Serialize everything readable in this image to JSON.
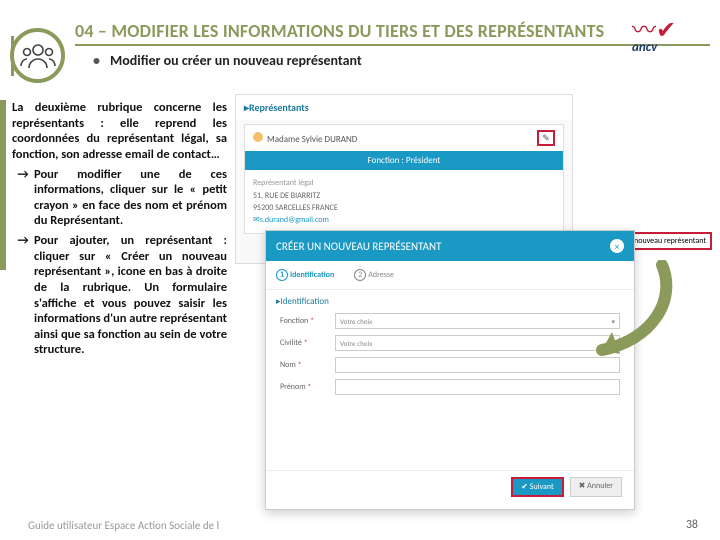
{
  "header": {
    "title": "04 – MODIFIER LES INFORMATIONS DU TIERS ET DES REPRÉSENTANTS",
    "subtitle": "Modifier ou créer un nouveau représentant"
  },
  "logo": {
    "brand": "ancv"
  },
  "body": {
    "intro": "La deuxième rubrique concerne les représentants : elle reprend les coordonnées du représentant légal, sa fonction, son adresse email de contact…",
    "point1": "Pour modifier une de ces informations, cliquer sur le « petit crayon » en face des nom et prénom du Représentant.",
    "point2": "Pour ajouter, un représentant : cliquer sur « Créer un nouveau représentant », icone en bas à droite de la rubrique. Un formulaire s'affiche et vous pouvez saisir les informations d'un autre représentant ainsi que sa fonction au sein de votre structure."
  },
  "ss1": {
    "section": "Représentants",
    "name_line": "Madame Sylvie DURAND",
    "func_label": "Fonction : Président",
    "legal": "Représentant légal",
    "addr1": "51, RUE DE BIARRITZ",
    "addr2": "95200 SARCELLES FRANCE",
    "mail": "s.durand@gmail.com"
  },
  "create_btn": "Créer un nouveau représentant",
  "ss2": {
    "title": "CRÉER UN NOUVEAU REPRÉSENTANT",
    "step1": "Identification",
    "step2": "Adresse",
    "section": "Identification",
    "labels": {
      "fonction": "Fonction",
      "civilite": "Civilité",
      "nom": "Nom",
      "prenom": "Prénom"
    },
    "placeholders": {
      "select": "Votre choix"
    },
    "btn_next": "Suivant",
    "btn_cancel": "Annuler"
  },
  "footer": "Guide utilisateur Espace Action Sociale de l",
  "page": "38"
}
